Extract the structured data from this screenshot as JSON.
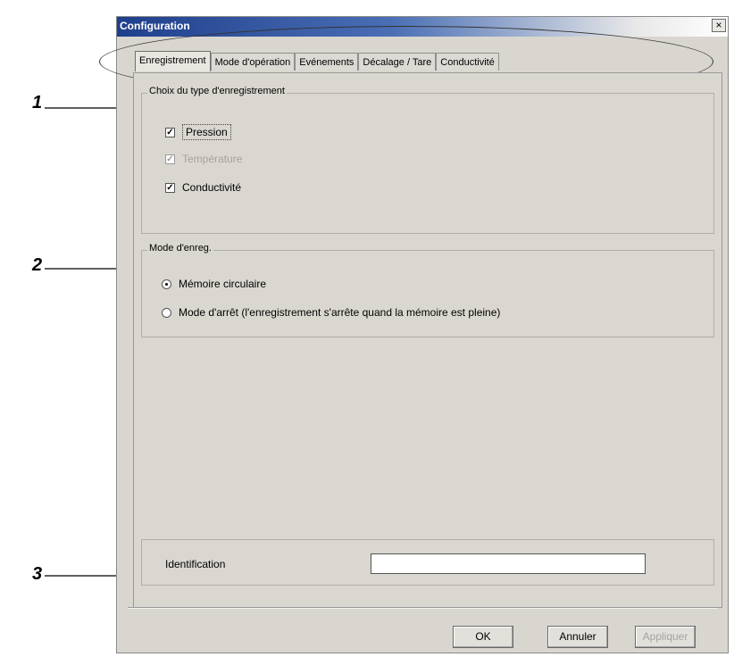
{
  "window": {
    "title": "Configuration",
    "close_label": "×"
  },
  "tabs": [
    {
      "label": "Enregistrement",
      "active": true
    },
    {
      "label": "Mode d'opération",
      "active": false
    },
    {
      "label": "Evénements",
      "active": false
    },
    {
      "label": "Décalage / Tare",
      "active": false
    },
    {
      "label": "Conductivité",
      "active": false
    }
  ],
  "recording_type": {
    "title": "Choix du type d'enregistrement",
    "pressure": {
      "label": "Pression",
      "checked": true,
      "enabled": true
    },
    "temperature": {
      "label": "Température",
      "checked": true,
      "enabled": false
    },
    "conductivity": {
      "label": "Conductivité",
      "checked": true,
      "enabled": true
    }
  },
  "recording_mode": {
    "title": "Mode d'enreg.",
    "circular": {
      "label": "Mémoire circulaire",
      "selected": true
    },
    "stop": {
      "label": "Mode d'arrêt (l'enregistrement s'arrête quand la mémoire est pleine)",
      "selected": false
    }
  },
  "identification": {
    "label": "Identification",
    "value": ""
  },
  "buttons": {
    "ok": "OK",
    "cancel": "Annuler",
    "apply": "Appliquer"
  },
  "callouts": [
    "1",
    "2",
    "3"
  ]
}
